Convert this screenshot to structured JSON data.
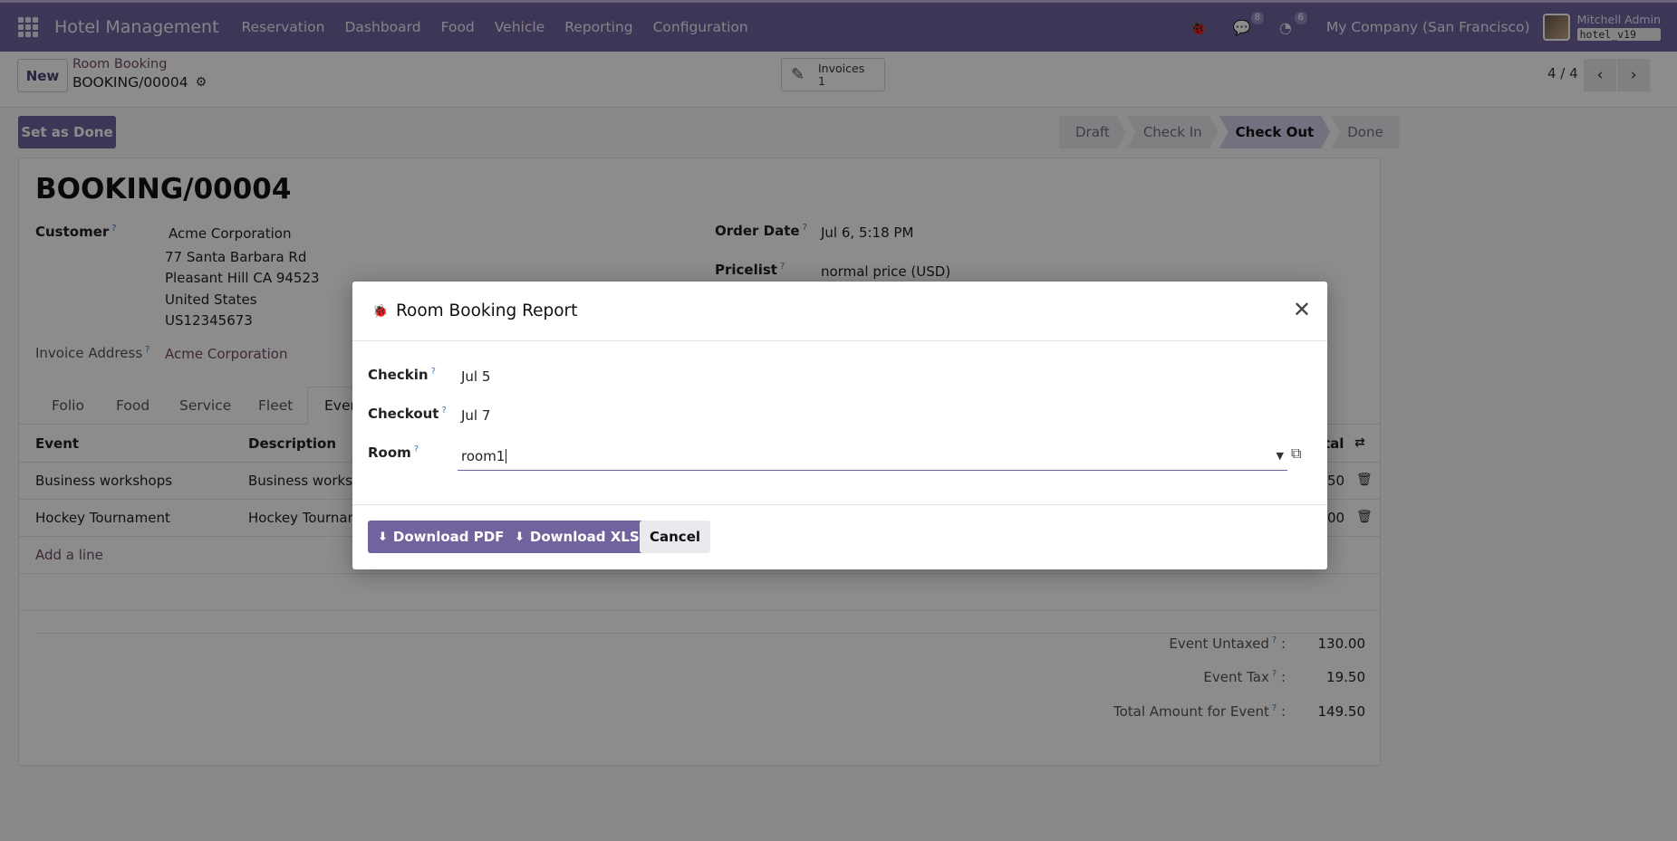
{
  "navbar": {
    "brand": "Hotel Management",
    "menu": [
      "Reservation",
      "Dashboard",
      "Food",
      "Vehicle",
      "Reporting",
      "Configuration"
    ],
    "messages_count": "8",
    "activities_count": "6",
    "company": "My Company (San Francisco)",
    "user_name": "Mitchell Admin",
    "db_name": "hotel_v19",
    "color": "#71639e"
  },
  "control": {
    "new_label": "New",
    "breadcrumb": "Room Booking",
    "record_name": "BOOKING/00004",
    "invoices_label": "Invoices",
    "invoices_count": "1",
    "pager": "4 / 4"
  },
  "form": {
    "set_done_label": "Set as Done",
    "stages": [
      "Draft",
      "Check In",
      "Check Out",
      "Done"
    ],
    "active_stage": "Check Out",
    "title": "BOOKING/00004",
    "customer_label": "Customer",
    "customer_name": "Acme Corporation",
    "address": [
      "77 Santa Barbara Rd",
      "Pleasant Hill CA 94523",
      "United States",
      "US12345673"
    ],
    "invoice_address_label": "Invoice Address",
    "invoice_address": "Acme Corporation",
    "order_date_label": "Order Date",
    "order_date": "Jul 6, 5:18 PM",
    "pricelist_label": "Pricelist",
    "pricelist": "normal price (USD)",
    "tabs": [
      "Folio",
      "Food",
      "Service",
      "Fleet",
      "Even"
    ],
    "table_headers": {
      "event": "Event",
      "description": "Description",
      "total": "tal"
    },
    "rows": [
      {
        "event": "Business workshops",
        "description": "Business worksh",
        "total": "50"
      },
      {
        "event": "Hockey Tournament",
        "description": "Hockey Tournam",
        "total": "00"
      }
    ],
    "add_line": "Add a line",
    "totals": [
      {
        "label": "Event Untaxed",
        "value": "130.00"
      },
      {
        "label": "Event Tax",
        "value": "19.50"
      },
      {
        "label": "Total Amount for Event",
        "value": "149.50"
      }
    ]
  },
  "modal": {
    "title": "Room Booking Report",
    "checkin_label": "Checkin",
    "checkin_value": "Jul 5",
    "checkout_label": "Checkout",
    "checkout_value": "Jul 7",
    "room_label": "Room",
    "room_value": "room1",
    "download_pdf": "Download PDF",
    "download_xls": "Download XLS",
    "cancel": "Cancel"
  }
}
